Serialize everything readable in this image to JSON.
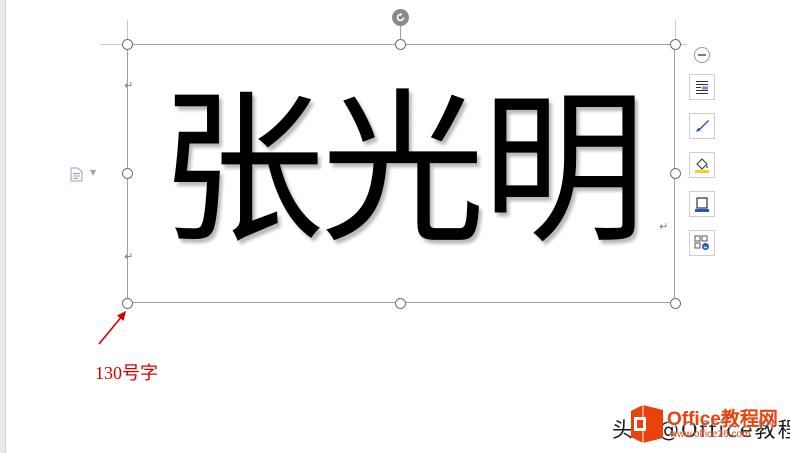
{
  "textbox": {
    "text": "张光明"
  },
  "annotation": {
    "label": "130号字",
    "color": "#d40000"
  },
  "floating_toolbar": {
    "collapse_icon": "minus-circle-icon",
    "tools": [
      {
        "name": "text-wrap-button",
        "icon": "text-wrap-icon"
      },
      {
        "name": "text-effect-brush-button",
        "icon": "brush-icon"
      },
      {
        "name": "fill-color-button",
        "icon": "paint-bucket-icon"
      },
      {
        "name": "outline-button",
        "icon": "shape-outline-icon"
      },
      {
        "name": "layout-options-button",
        "icon": "layout-options-icon"
      }
    ]
  },
  "watermark": {
    "text": "头条@Office教程网",
    "logo_title": "Office教程网",
    "logo_url": "www.office26.com"
  },
  "colors": {
    "accent_blue": "#2457c5",
    "brand_orange": "#e8430d",
    "annotation_red": "#d40000"
  }
}
